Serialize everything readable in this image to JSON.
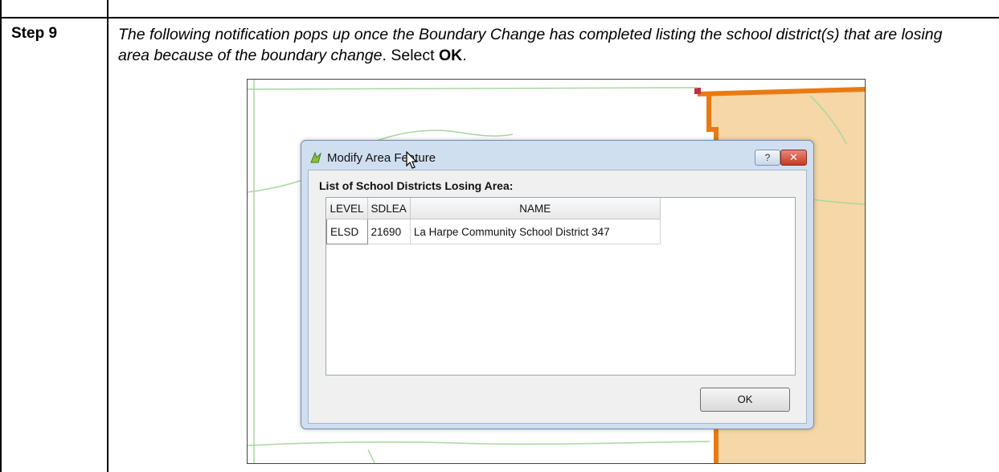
{
  "doc": {
    "step_label": "Step 9",
    "instruction_italic": "The following notification pops up once the Boundary Change has completed listing the school district(s) that are losing area because of the boundary change",
    "instruction_select": ". Select ",
    "instruction_ok": "OK",
    "instruction_end": "."
  },
  "dialog": {
    "title": "Modify Area Feature",
    "app_icon": "qgis-icon",
    "help_label": "?",
    "close_label": "✕",
    "list_label": "List of School Districts Losing Area:",
    "columns": [
      "LEVEL",
      "SDLEA",
      "NAME"
    ],
    "rows": [
      {
        "level": "ELSD",
        "sdlea": "21690",
        "name": "La Harpe Community School District 347"
      }
    ],
    "ok_label": "OK"
  },
  "colors": {
    "map_fill": "#f6d7a7",
    "boundary_orange": "#e87a14",
    "road_green": "#a9d6a0",
    "dialog_frame": "#cfdff0"
  }
}
